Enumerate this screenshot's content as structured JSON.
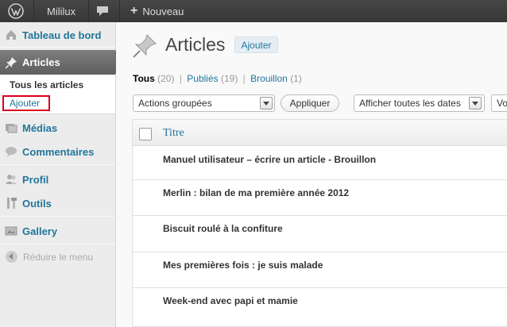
{
  "adminbar": {
    "site_name": "Mililux",
    "new_label": "Nouveau"
  },
  "sidebar": {
    "dashboard": "Tableau de bord",
    "articles": "Articles",
    "submenu": [
      "Tous les articles",
      "Ajouter"
    ],
    "medias": "Médias",
    "comments": "Commentaires",
    "profile": "Profil",
    "tools": "Outils",
    "gallery": "Gallery",
    "collapse": "Réduire le menu"
  },
  "main": {
    "title": "Articles",
    "add_button": "Ajouter",
    "filters": {
      "all_label": "Tous",
      "all_count": "(20)",
      "published_label": "Publiés",
      "published_count": "(19)",
      "draft_label": "Brouillon",
      "draft_count": "(1)",
      "separator": "|"
    },
    "bulk_actions": "Actions groupées",
    "apply_button": "Appliquer",
    "date_filter": "Afficher toutes les dates",
    "partial_select": "Vo",
    "table": {
      "column_title": "Titre",
      "rows": [
        "Manuel utilisateur – écrire un article - Brouillon",
        "Merlin : bilan de ma première année 2012",
        "Biscuit roulé à la confiture",
        "Mes premières fois : je suis malade",
        "Week-end avec papi et mamie"
      ]
    }
  },
  "colors": {
    "link": "#21759b",
    "adminbar": "#464646",
    "highlight_box": "#d9001b"
  }
}
